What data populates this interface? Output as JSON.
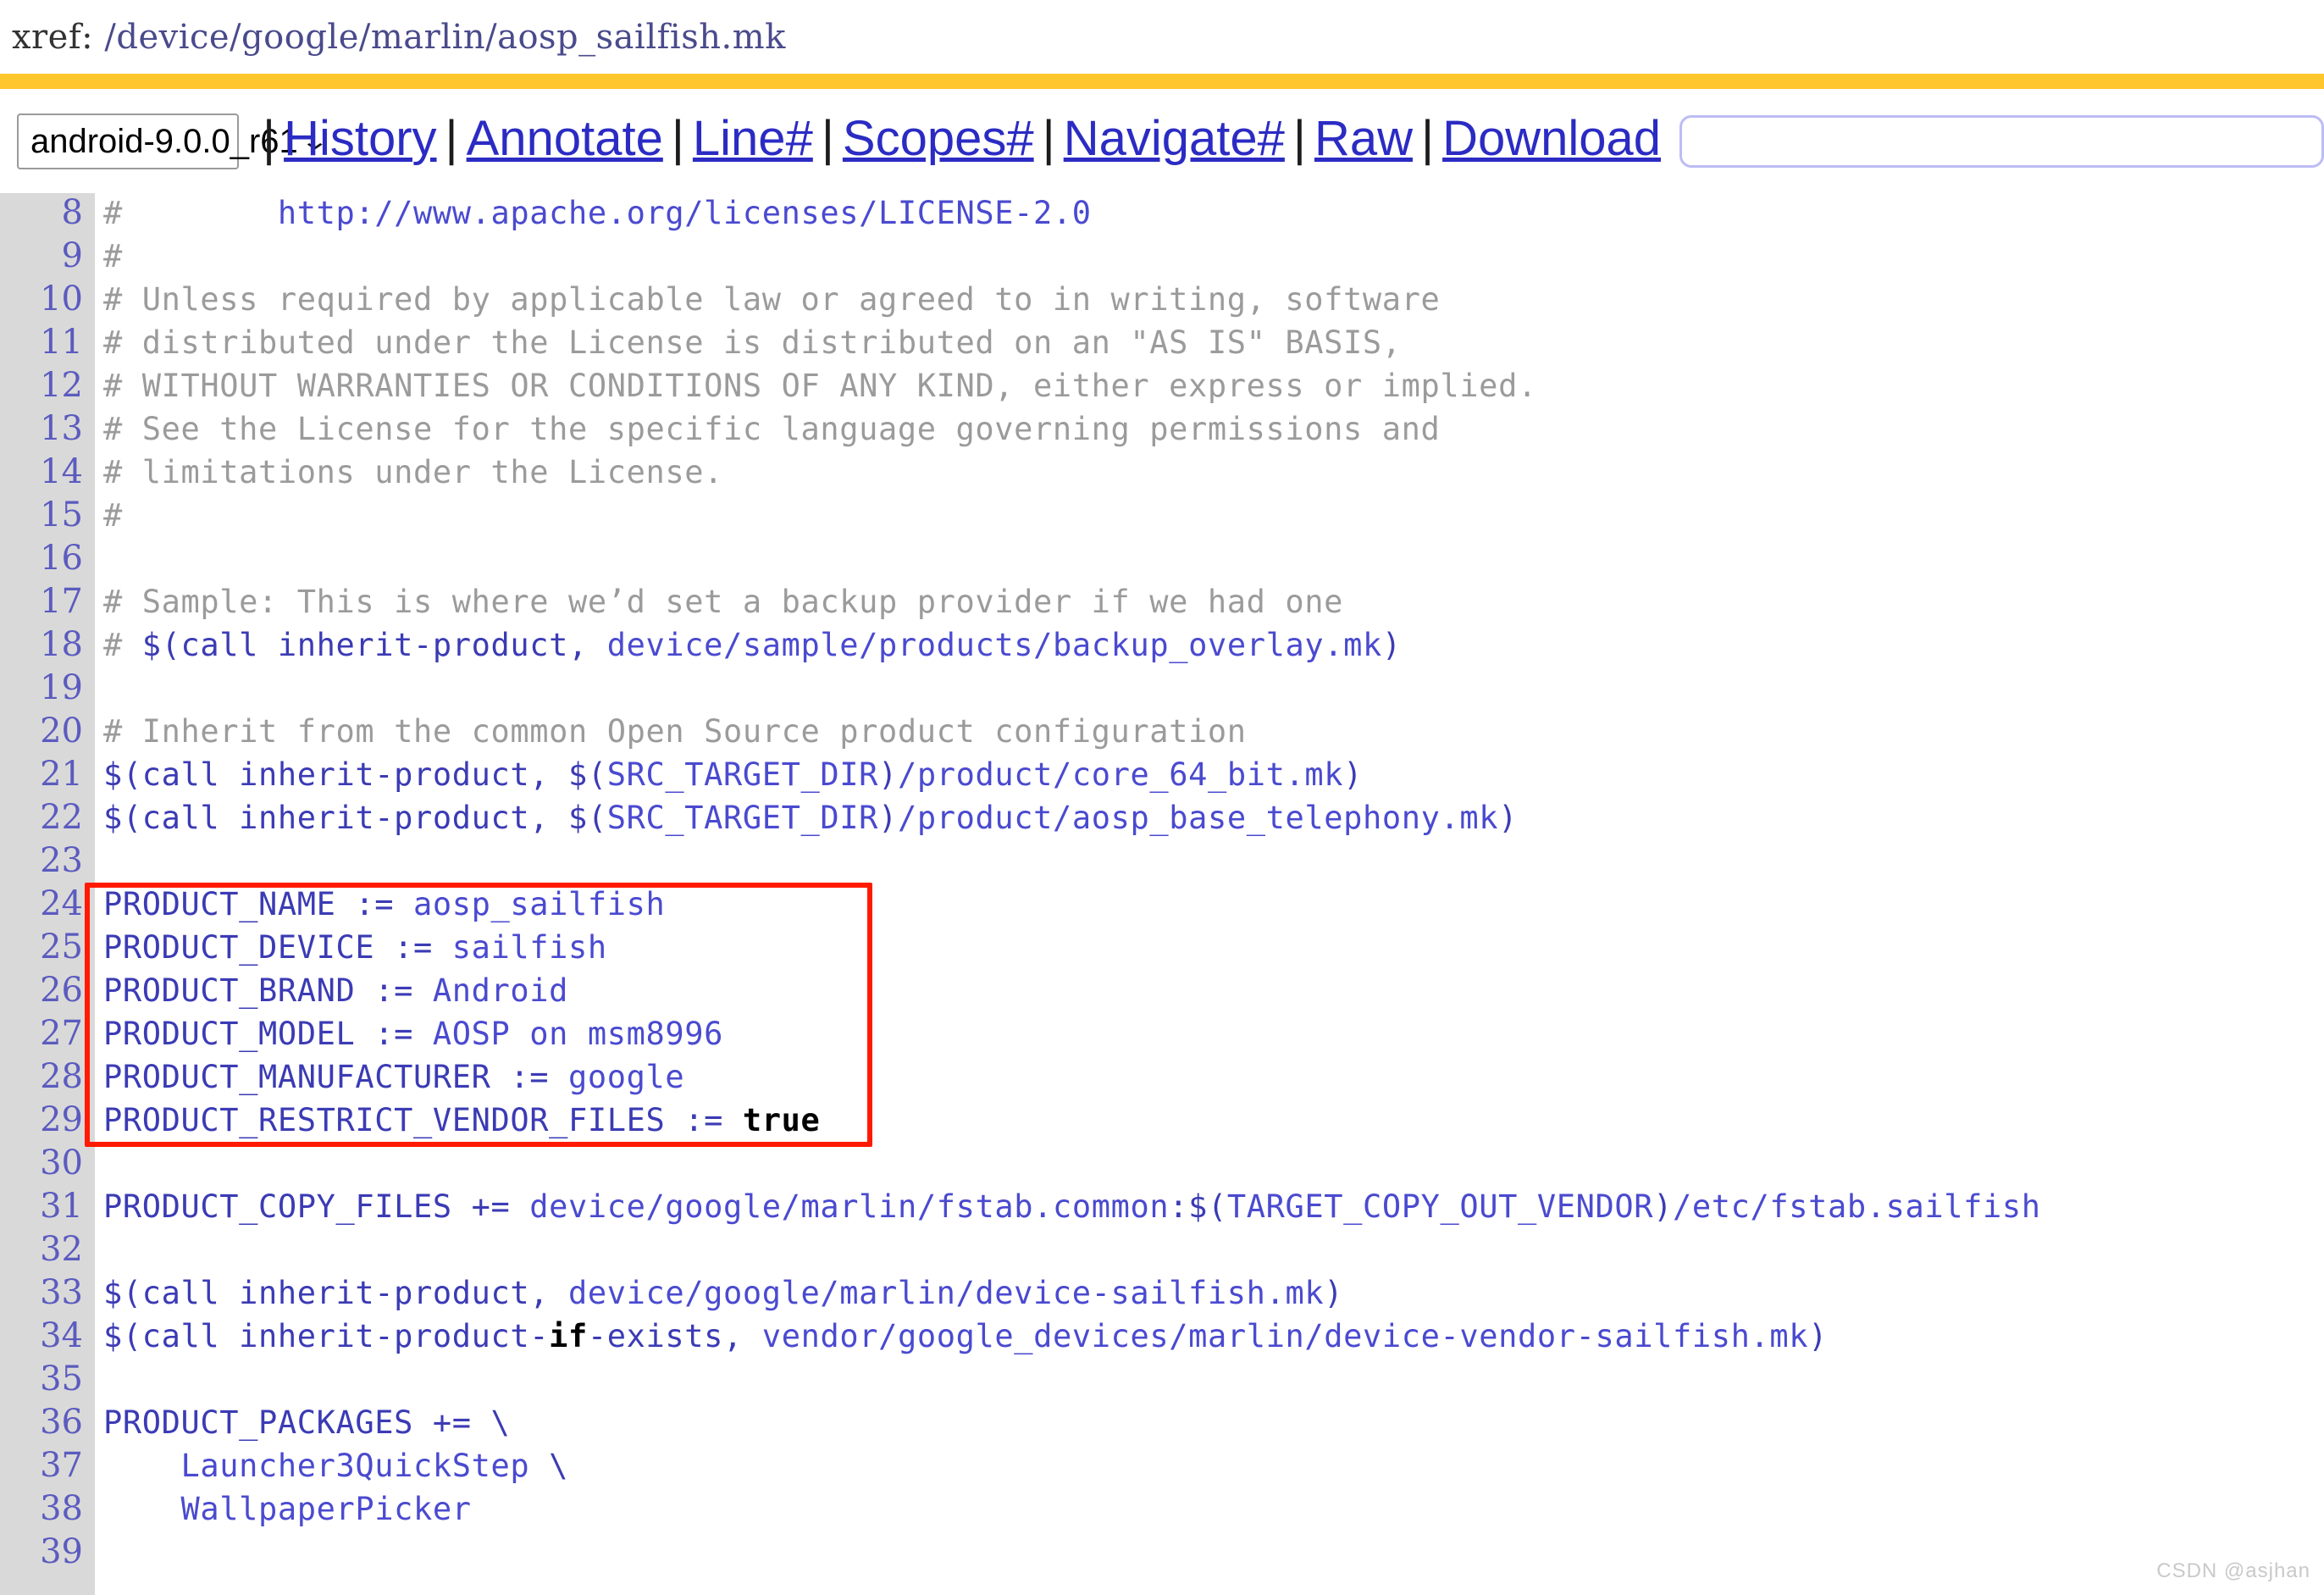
{
  "header": {
    "xref_label": "xref: ",
    "file_path": "/device/google/marlin/aosp_sailfish.mk"
  },
  "colors": {
    "accent_rule": "#FFC62D",
    "link": "#2B2BC4",
    "code_blue": "#3b3bb5",
    "comment_gray": "#9b9b9b",
    "highlight_box": "#FF1A00",
    "gutter_bg": "#d9d9d9"
  },
  "toolbar": {
    "version_select": {
      "value": "android-9.0.0_r61",
      "chevron": "⌄"
    },
    "separator": "|",
    "links": [
      {
        "label": "History"
      },
      {
        "label": "Annotate"
      },
      {
        "label": "Line#"
      },
      {
        "label": "Scopes#"
      },
      {
        "label": "Navigate#"
      },
      {
        "label": "Raw"
      },
      {
        "label": "Download"
      }
    ],
    "search": {
      "value": "",
      "placeholder": ""
    }
  },
  "code": {
    "lines": [
      {
        "no": "8",
        "tokens": [
          {
            "t": "comment",
            "v": "#        "
          },
          {
            "t": "link",
            "v": "http://www.apache.org/licenses/LICENSE-2.0"
          }
        ]
      },
      {
        "no": "9",
        "tokens": [
          {
            "t": "comment",
            "v": "#"
          }
        ]
      },
      {
        "no": "10",
        "tokens": [
          {
            "t": "comment",
            "v": "# Unless required by applicable law or agreed to in writing, software"
          }
        ]
      },
      {
        "no": "11",
        "tokens": [
          {
            "t": "comment",
            "v": "# distributed under the License is distributed on an \"AS IS\" BASIS,"
          }
        ]
      },
      {
        "no": "12",
        "tokens": [
          {
            "t": "comment",
            "v": "# WITHOUT WARRANTIES OR CONDITIONS OF ANY KIND, either express or implied."
          }
        ]
      },
      {
        "no": "13",
        "tokens": [
          {
            "t": "comment",
            "v": "# See the License for the specific language governing permissions and"
          }
        ]
      },
      {
        "no": "14",
        "tokens": [
          {
            "t": "comment",
            "v": "# limitations under the License."
          }
        ]
      },
      {
        "no": "15",
        "tokens": [
          {
            "t": "comment",
            "v": "#"
          }
        ]
      },
      {
        "no": "16",
        "tokens": []
      },
      {
        "no": "17",
        "tokens": [
          {
            "t": "comment",
            "v": "# Sample: This is where we’d set a backup provider if we had one"
          }
        ]
      },
      {
        "no": "18",
        "tokens": [
          {
            "t": "comment",
            "v": "# "
          },
          {
            "t": "plain",
            "v": "$(call inherit-product, "
          },
          {
            "t": "link",
            "v": "device/sample/products/backup_overlay.mk"
          },
          {
            "t": "plain",
            "v": ")"
          }
        ]
      },
      {
        "no": "19",
        "tokens": []
      },
      {
        "no": "20",
        "tokens": [
          {
            "t": "comment",
            "v": "# Inherit from the common Open Source product configuration"
          }
        ]
      },
      {
        "no": "21",
        "tokens": [
          {
            "t": "plain",
            "v": "$(call inherit-product, $("
          },
          {
            "t": "link",
            "v": "SRC_TARGET_DIR"
          },
          {
            "t": "plain",
            "v": ")"
          },
          {
            "t": "link",
            "v": "/product/core_64_bit.mk"
          },
          {
            "t": "plain",
            "v": ")"
          }
        ]
      },
      {
        "no": "22",
        "tokens": [
          {
            "t": "plain",
            "v": "$(call inherit-product, $("
          },
          {
            "t": "link",
            "v": "SRC_TARGET_DIR"
          },
          {
            "t": "plain",
            "v": ")"
          },
          {
            "t": "link",
            "v": "/product/aosp_base_telephony.mk"
          },
          {
            "t": "plain",
            "v": ")"
          }
        ]
      },
      {
        "no": "23",
        "tokens": []
      },
      {
        "no": "24",
        "tokens": [
          {
            "t": "var",
            "v": "PRODUCT_NAME"
          },
          {
            "t": "plain",
            "v": " := "
          },
          {
            "t": "link",
            "v": "aosp_sailfish"
          }
        ]
      },
      {
        "no": "25",
        "tokens": [
          {
            "t": "var",
            "v": "PRODUCT_DEVICE"
          },
          {
            "t": "plain",
            "v": " := "
          },
          {
            "t": "link",
            "v": "sailfish"
          }
        ]
      },
      {
        "no": "26",
        "tokens": [
          {
            "t": "var",
            "v": "PRODUCT_BRAND"
          },
          {
            "t": "plain",
            "v": " := "
          },
          {
            "t": "link",
            "v": "Android"
          }
        ]
      },
      {
        "no": "27",
        "tokens": [
          {
            "t": "var",
            "v": "PRODUCT_MODEL"
          },
          {
            "t": "plain",
            "v": " := "
          },
          {
            "t": "link",
            "v": "AOSP on msm8996"
          }
        ]
      },
      {
        "no": "28",
        "tokens": [
          {
            "t": "var",
            "v": "PRODUCT_MANUFACTURER"
          },
          {
            "t": "plain",
            "v": " := "
          },
          {
            "t": "link",
            "v": "google"
          }
        ]
      },
      {
        "no": "29",
        "tokens": [
          {
            "t": "var",
            "v": "PRODUCT_RESTRICT_VENDOR_FILES"
          },
          {
            "t": "plain",
            "v": " := "
          },
          {
            "t": "kw",
            "v": "true"
          }
        ]
      },
      {
        "no": "30",
        "tokens": []
      },
      {
        "no": "31",
        "tokens": [
          {
            "t": "var",
            "v": "PRODUCT_COPY_FILES"
          },
          {
            "t": "plain",
            "v": " += "
          },
          {
            "t": "link",
            "v": "device/google/marlin/fstab.common"
          },
          {
            "t": "plain",
            "v": ":$("
          },
          {
            "t": "link",
            "v": "TARGET_COPY_OUT_VENDOR"
          },
          {
            "t": "plain",
            "v": ")"
          },
          {
            "t": "link",
            "v": "/etc/fstab.sailfish"
          }
        ]
      },
      {
        "no": "32",
        "tokens": []
      },
      {
        "no": "33",
        "tokens": [
          {
            "t": "plain",
            "v": "$(call inherit-product, "
          },
          {
            "t": "link",
            "v": "device/google/marlin/device-sailfish.mk"
          },
          {
            "t": "plain",
            "v": ")"
          }
        ]
      },
      {
        "no": "34",
        "tokens": [
          {
            "t": "plain",
            "v": "$(call inherit-product-"
          },
          {
            "t": "kw",
            "v": "if"
          },
          {
            "t": "plain",
            "v": "-exists, "
          },
          {
            "t": "link",
            "v": "vendor/google_devices/marlin/device-vendor-sailfish.mk"
          },
          {
            "t": "plain",
            "v": ")"
          }
        ]
      },
      {
        "no": "35",
        "tokens": []
      },
      {
        "no": "36",
        "tokens": [
          {
            "t": "var",
            "v": "PRODUCT_PACKAGES"
          },
          {
            "t": "plain",
            "v": " += \\"
          }
        ]
      },
      {
        "no": "37",
        "tokens": [
          {
            "t": "link",
            "v": "    Launcher3QuickStep"
          },
          {
            "t": "plain",
            "v": " \\"
          }
        ]
      },
      {
        "no": "38",
        "tokens": [
          {
            "t": "link",
            "v": "    WallpaperPicker"
          }
        ]
      },
      {
        "no": "39",
        "tokens": []
      }
    ],
    "highlight": {
      "first_line": "24",
      "last_line": "29"
    }
  },
  "watermark": "CSDN @asjhan"
}
